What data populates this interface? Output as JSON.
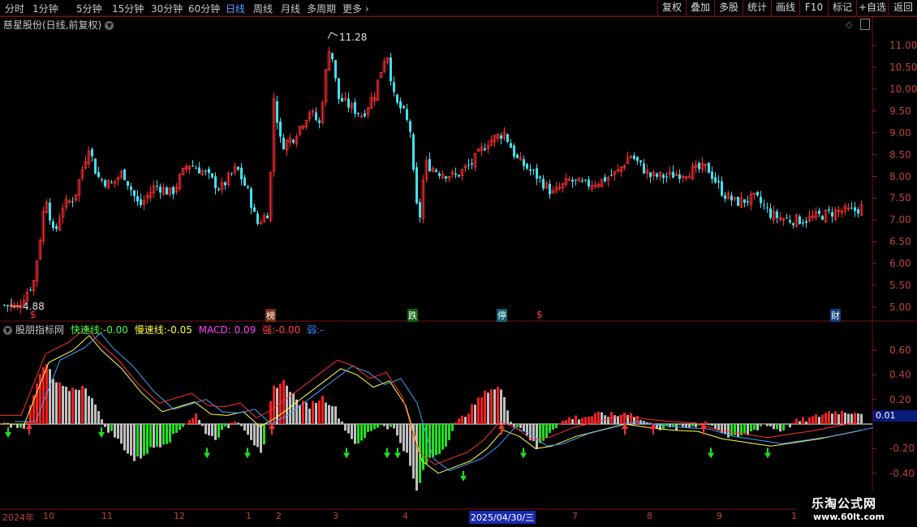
{
  "toolbar": {
    "periods": [
      "分时",
      "1分钟",
      "5分钟",
      "15分钟",
      "30分钟",
      "60分钟",
      "日线",
      "周线",
      "月线",
      "多周期",
      "更多"
    ],
    "active_period": "日线",
    "right_buttons": [
      "复权",
      "叠加",
      "多股",
      "统计",
      "画线",
      "F10",
      "标记",
      "+自选",
      "返回"
    ]
  },
  "main_chart": {
    "title": "慈星股份(日线,前复权)",
    "high_label": "11.28",
    "low_label": "4.88",
    "price_ticks": [
      "11.00",
      "10.50",
      "10.00",
      "9.50",
      "9.00",
      "8.50",
      "8.00",
      "7.50",
      "7.00",
      "6.50",
      "6.00",
      "5.50",
      "5.00"
    ],
    "event_markers": [
      {
        "text": "$",
        "color": "#ff4040"
      },
      {
        "text": "榜",
        "color": "#ffffff",
        "bg": "#7a3010"
      },
      {
        "text": "跌",
        "color": "#ffffff",
        "bg": "#106010"
      },
      {
        "text": "停",
        "color": "#ffffff",
        "bg": "#106070"
      },
      {
        "text": "$",
        "color": "#ff4040"
      },
      {
        "text": "财",
        "color": "#ffffff",
        "bg": "#104080"
      }
    ]
  },
  "indicator": {
    "name": "股朋指标网",
    "items": [
      {
        "label": "快速线:",
        "value": "-0.00",
        "color": "#40ff40"
      },
      {
        "label": "慢速线:",
        "value": "-0.05",
        "color": "#ffff40"
      },
      {
        "label": "MACD:",
        "value": "0.09",
        "color": "#ff40ff"
      },
      {
        "label": "强:",
        "value": "-0.00",
        "color": "#ff4040"
      },
      {
        "label": "弱:",
        "value": "-",
        "color": "#4080ff"
      }
    ],
    "ticks": [
      "0.60",
      "0.40",
      "0.20",
      "-0.20",
      "-0.40"
    ],
    "current_value": "0.01"
  },
  "date_axis": {
    "labels": [
      "2024年",
      "10",
      "11",
      "12",
      "1",
      "2",
      "3",
      "4",
      "2025/04/30/三",
      "7",
      "8",
      "9",
      "1"
    ]
  },
  "watermark": {
    "line1": "乐淘公式网",
    "line2": "www.60lt.com"
  },
  "colors": {
    "up": "#ff3030",
    "down": "#40e0f0",
    "accent": "#5aa0ff",
    "grid": "#7a1010"
  }
}
